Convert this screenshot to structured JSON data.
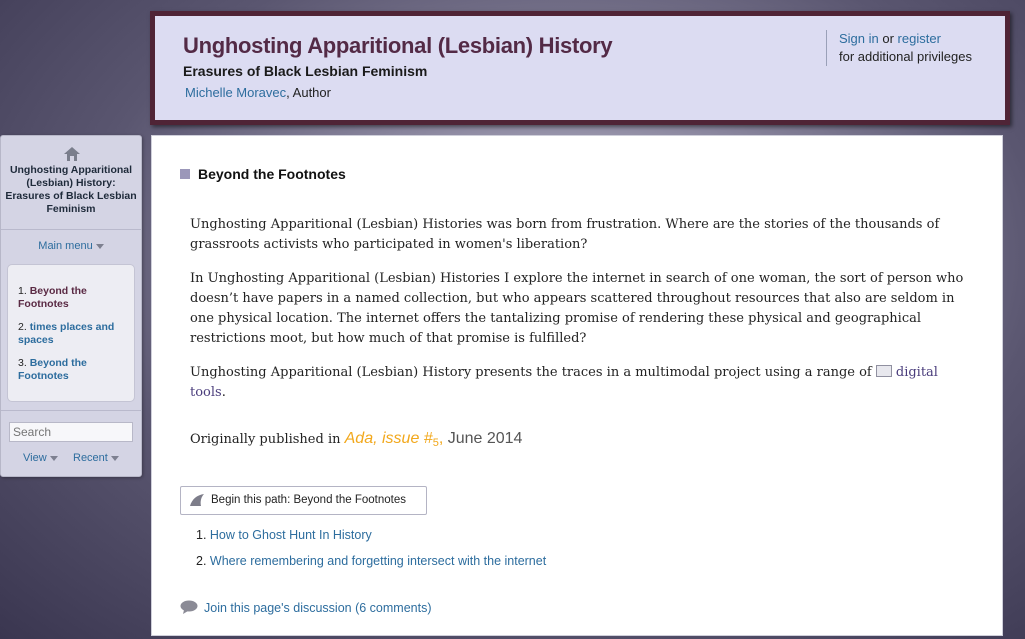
{
  "header": {
    "title": "Unghosting Apparitional (Lesbian) History",
    "subtitle": "Erasures of Black Lesbian Feminism",
    "author_name": "Michelle Moravec",
    "author_role": ", Author",
    "sign_in": "Sign in",
    "or_text": " or ",
    "register": "register",
    "privileges_text": "for additional privileges"
  },
  "sidebar": {
    "home_icon": "home-icon",
    "book_title": "Unghosting Apparitional (Lesbian) History: Erasures of Black Lesbian Feminism",
    "main_menu": "Main menu",
    "items": [
      {
        "num": "1. ",
        "label": "Beyond the Footnotes",
        "current": true
      },
      {
        "num": "2. ",
        "label": "times places and spaces",
        "current": false
      },
      {
        "num": "3. ",
        "label": "Beyond the Footnotes",
        "current": false
      }
    ],
    "search_placeholder": "Search",
    "view": "View",
    "recent": "Recent"
  },
  "content": {
    "page_title": "Beyond the Footnotes",
    "paragraphs": [
      "Unghosting Apparitional (Lesbian) Histories was born from frustration. Where are the stories of the thousands of grassroots activists who participated in women's liberation?",
      "In Unghosting Apparitional (Lesbian) Histories I explore the internet in search of one woman, the sort of person who doesn’t have papers in a named collection, but who appears scattered throughout  resources that also are seldom in one physical location. The internet offers the tantalizing promise of rendering these physical and geographical restrictions moot, but how much of that promise is fulfilled?"
    ],
    "p3_before": "Unghosting Apparitional (Lesbian) History presents the traces in a multimodal project using a range of ",
    "p3_link": "digital tools",
    "p3_after": ".",
    "published_prefix": "Originally published in ",
    "published_journal": "Ada, issue #",
    "published_issue_num": "5",
    "published_comma": ",",
    "published_date": " June 2014",
    "path_button": "Begin this path: Beyond the Footnotes",
    "path_items": [
      {
        "num": "1. ",
        "label": "How to Ghost Hunt In History"
      },
      {
        "num": "2. ",
        "label": "Where remembering and forgetting intersect with the internet"
      }
    ],
    "discussion": "Join this page's discussion (6 comments)"
  },
  "colors": {
    "header_border": "#4f2436",
    "header_bg": "#dcdcf2",
    "title_color": "#532a46",
    "link_color": "#2d6d9e",
    "accent_orange": "#f2a81c"
  }
}
